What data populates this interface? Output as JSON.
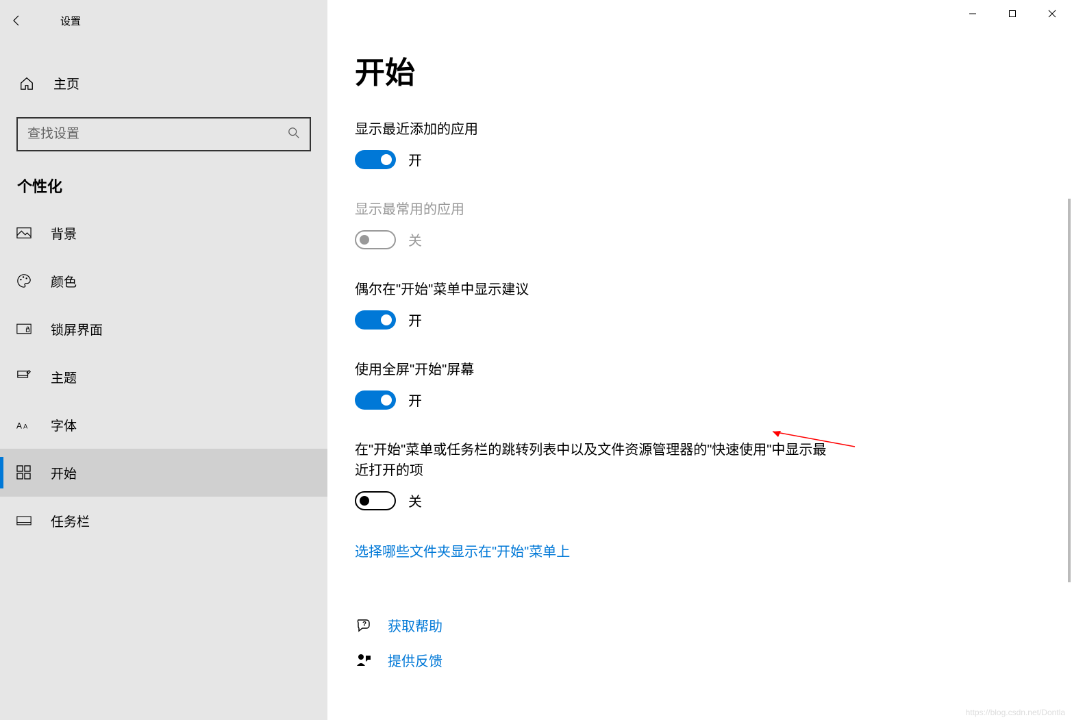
{
  "window": {
    "title": "设置"
  },
  "sidebar": {
    "home": "主页",
    "search_placeholder": "查找设置",
    "section": "个性化",
    "items": [
      {
        "label": "背景"
      },
      {
        "label": "颜色"
      },
      {
        "label": "锁屏界面"
      },
      {
        "label": "主题"
      },
      {
        "label": "字体"
      },
      {
        "label": "开始"
      },
      {
        "label": "任务栏"
      }
    ]
  },
  "main": {
    "title": "开始",
    "settings": [
      {
        "label": "显示最近添加的应用",
        "state": "on",
        "state_text": "开"
      },
      {
        "label": "显示最常用的应用",
        "state": "disabled-off",
        "state_text": "关"
      },
      {
        "label": "偶尔在\"开始\"菜单中显示建议",
        "state": "on",
        "state_text": "开"
      },
      {
        "label": "使用全屏\"开始\"屏幕",
        "state": "on",
        "state_text": "开"
      },
      {
        "label": "在\"开始\"菜单或任务栏的跳转列表中以及文件资源管理器的\"快速使用\"中显示最近打开的项",
        "state": "off",
        "state_text": "关"
      }
    ],
    "link": "选择哪些文件夹显示在\"开始\"菜单上",
    "help": {
      "get_help": "获取帮助",
      "feedback": "提供反馈"
    }
  },
  "watermark": "https://blog.csdn.net/Dontla"
}
